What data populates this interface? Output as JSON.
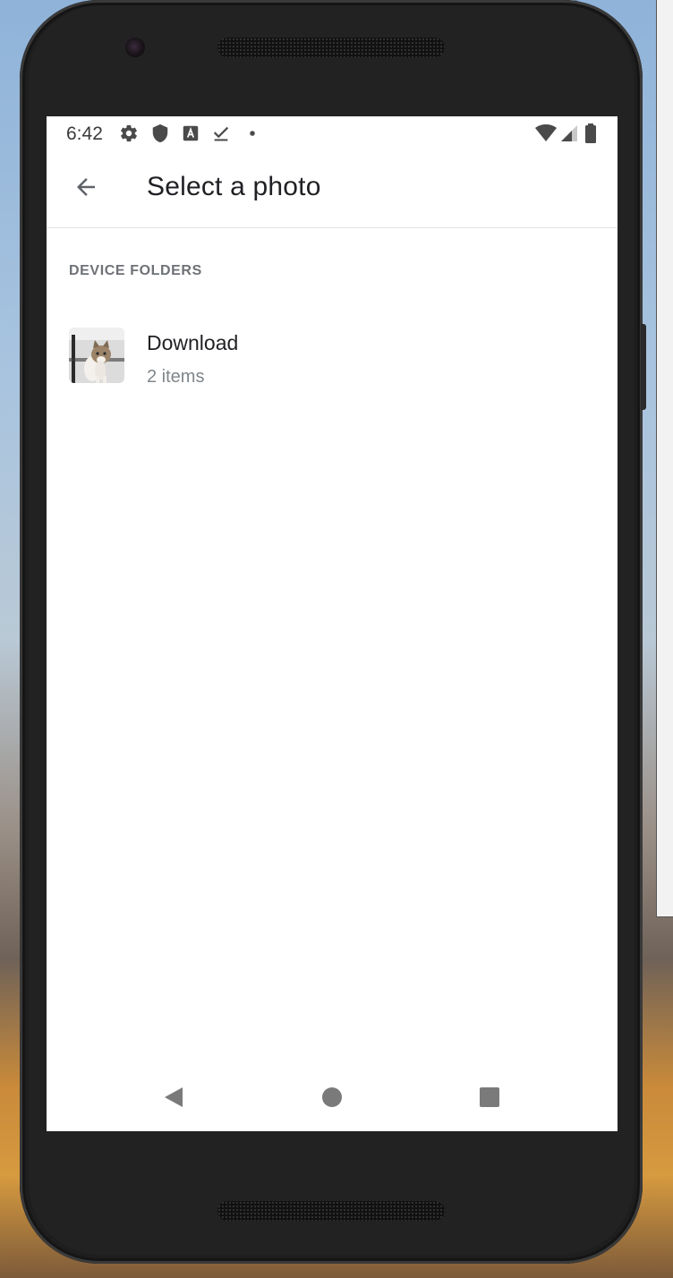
{
  "status_bar": {
    "time": "6:42",
    "left_icons": [
      "gear-icon",
      "shield-icon",
      "a-box-icon",
      "check-download-icon",
      "dot-icon"
    ],
    "right_icons": [
      "wifi-icon",
      "signal-icon",
      "battery-icon"
    ]
  },
  "app_bar": {
    "back_icon": "arrow-back-icon",
    "title": "Select a photo"
  },
  "main": {
    "section_header": "DEVICE FOLDERS",
    "folders": [
      {
        "name": "Download",
        "count": "2 items",
        "thumbnail": "kitten-photo"
      }
    ]
  },
  "nav_bar": {
    "icons": [
      "back-triangle-icon",
      "home-circle-icon",
      "recents-square-icon"
    ]
  },
  "colors": {
    "screen_bg": "#ffffff",
    "title_text": "#202124",
    "secondary_text": "#80868b",
    "section_header_text": "#6e7176",
    "nav_icon": "#7a7a7a",
    "phone_body": "#1e1e1e"
  }
}
